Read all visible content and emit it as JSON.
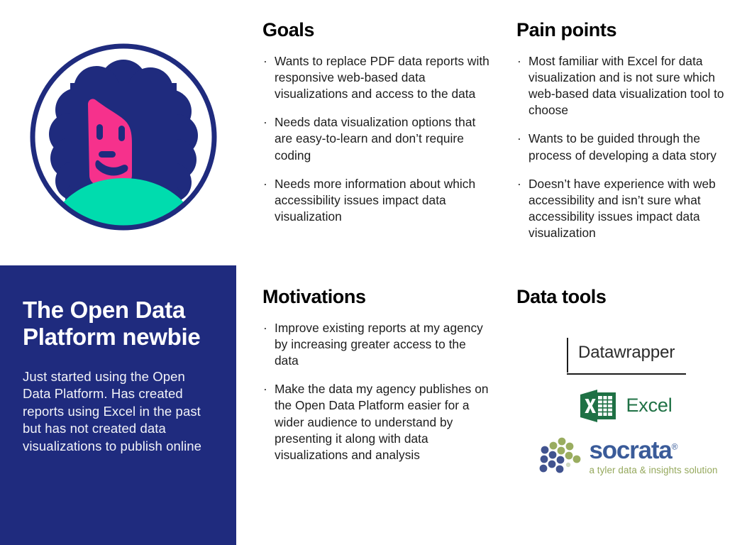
{
  "persona": {
    "title": "The Open Data Platform newbie",
    "description": "Just started using the Open Data Platform. Has created reports using Excel in the past but has not created data visualizations to publish online",
    "avatar_icon": "person-avatar-illustration",
    "avatar_colors": {
      "outline": "#1f2b7e",
      "hair": "#1f2b7e",
      "face": "#f6318c",
      "shirt": "#00dcae"
    }
  },
  "panel_color": "#1f2b7e",
  "bullet_glyph": "·",
  "sections": [
    {
      "id": "goals",
      "heading": "Goals",
      "bullets": [
        "Wants to replace PDF data reports with responsive web-based data visualizations and access to the data",
        "Needs data visualization options that are easy-to-learn and don’t require coding",
        "Needs more information about which accessibility issues impact data visualization"
      ]
    },
    {
      "id": "pain-points",
      "heading": "Pain points",
      "bullets": [
        "Most familiar with Excel for data visualization and is not sure which web-based data visualization tool to choose",
        "Wants to be guided through the process of developing a data story",
        "Doesn’t have experience with web accessibility and isn’t sure what accessibility issues impact data visualization"
      ]
    },
    {
      "id": "motivations",
      "heading": "Motivations",
      "bullets": [
        "Improve existing reports at my agency by increasing greater access to the data",
        "Make the data my agency publishes on the Open Data Platform easier for a wider audience to understand by presenting it along with data visualizations and analysis"
      ]
    }
  ],
  "data_tools": {
    "heading": "Data tools",
    "logos": [
      {
        "id": "datawrapper",
        "icon": "datawrapper-logo",
        "name": "Datawrapper",
        "color": "#2b2b2b"
      },
      {
        "id": "excel",
        "icon": "excel-logo",
        "name": "Excel",
        "color": "#1f7145"
      },
      {
        "id": "socrata",
        "icon": "socrata-logo",
        "name": "socrata",
        "registered_mark": "®",
        "tagline": "a tyler data & insights solution",
        "color": "#3a5b99",
        "tagline_color": "#95a85c"
      }
    ]
  }
}
